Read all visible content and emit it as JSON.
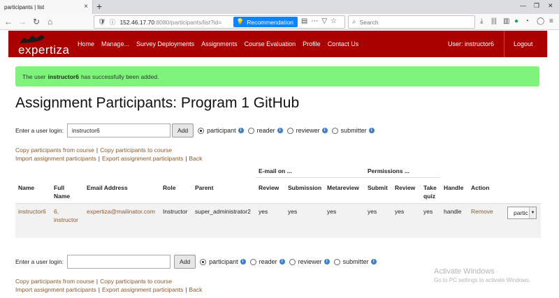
{
  "browser": {
    "tab_title": "participants | list",
    "tab_close": "×",
    "new_tab": "+",
    "url_host": "152.46.17.70",
    "url_rest": ":8080/participants/list?id=",
    "recommendation_label": "Recommendation",
    "search_placeholder": "Search"
  },
  "header": {
    "logo_text": "expertiza",
    "menu": [
      "Home",
      "Manage...",
      "Survey Deployments",
      "Assignments",
      "Course Evaluation",
      "Profile",
      "Contact Us"
    ],
    "user_label": "User: instructor6",
    "logout_label": "Logout",
    "brand_color": "#a90000"
  },
  "flash": {
    "prefix": "The user",
    "user": "instructor6",
    "suffix": "has successfully been added."
  },
  "page_title": "Assignment Participants: Program 1 GitHub",
  "add_form_top": {
    "label": "Enter a user login:",
    "value": "instructor6",
    "button": "Add"
  },
  "add_form_bottom": {
    "label": "Enter a user login:",
    "value": "",
    "button": "Add"
  },
  "roles": {
    "participant": "participant",
    "reader": "reader",
    "reviewer": "reviewer",
    "submitter": "submitter",
    "selected": "participant",
    "info_glyph": "i"
  },
  "links": {
    "copy_from": "Copy participants from course",
    "copy_to": "Copy participants to course",
    "import": "Import assignment participants",
    "export": "Export assignment participants",
    "back": "Back",
    "separator": "|"
  },
  "table": {
    "group_email": "E-mail on ...",
    "group_perm": "Permissions ...",
    "headers": {
      "name": "Name",
      "full_name_1": "Full",
      "full_name_2": "Name",
      "email": "Email Address",
      "role": "Role",
      "parent": "Parent",
      "review": "Review",
      "submission": "Submission",
      "metareview": "Metareview",
      "submit": "Submit",
      "review2": "Review",
      "take_quiz_1": "Take",
      "take_quiz_2": "quiz",
      "handle": "Handle",
      "action": "Action"
    },
    "row": {
      "name": "instructor6",
      "full_name_1": "6,",
      "full_name_2": "instructor",
      "email": "expertiza@mailinator.com",
      "role": "Instructor",
      "parent": "super_administrator2",
      "review": "yes",
      "submission": "yes",
      "metareview": "yes",
      "submit": "yes",
      "review2": "yes",
      "take_quiz": "yes",
      "handle": "handle",
      "action": "Remove",
      "role_select": "partic"
    }
  },
  "watermark": {
    "line1": "Activate Windows",
    "line2": "Go to PC settings to activate Windows."
  }
}
